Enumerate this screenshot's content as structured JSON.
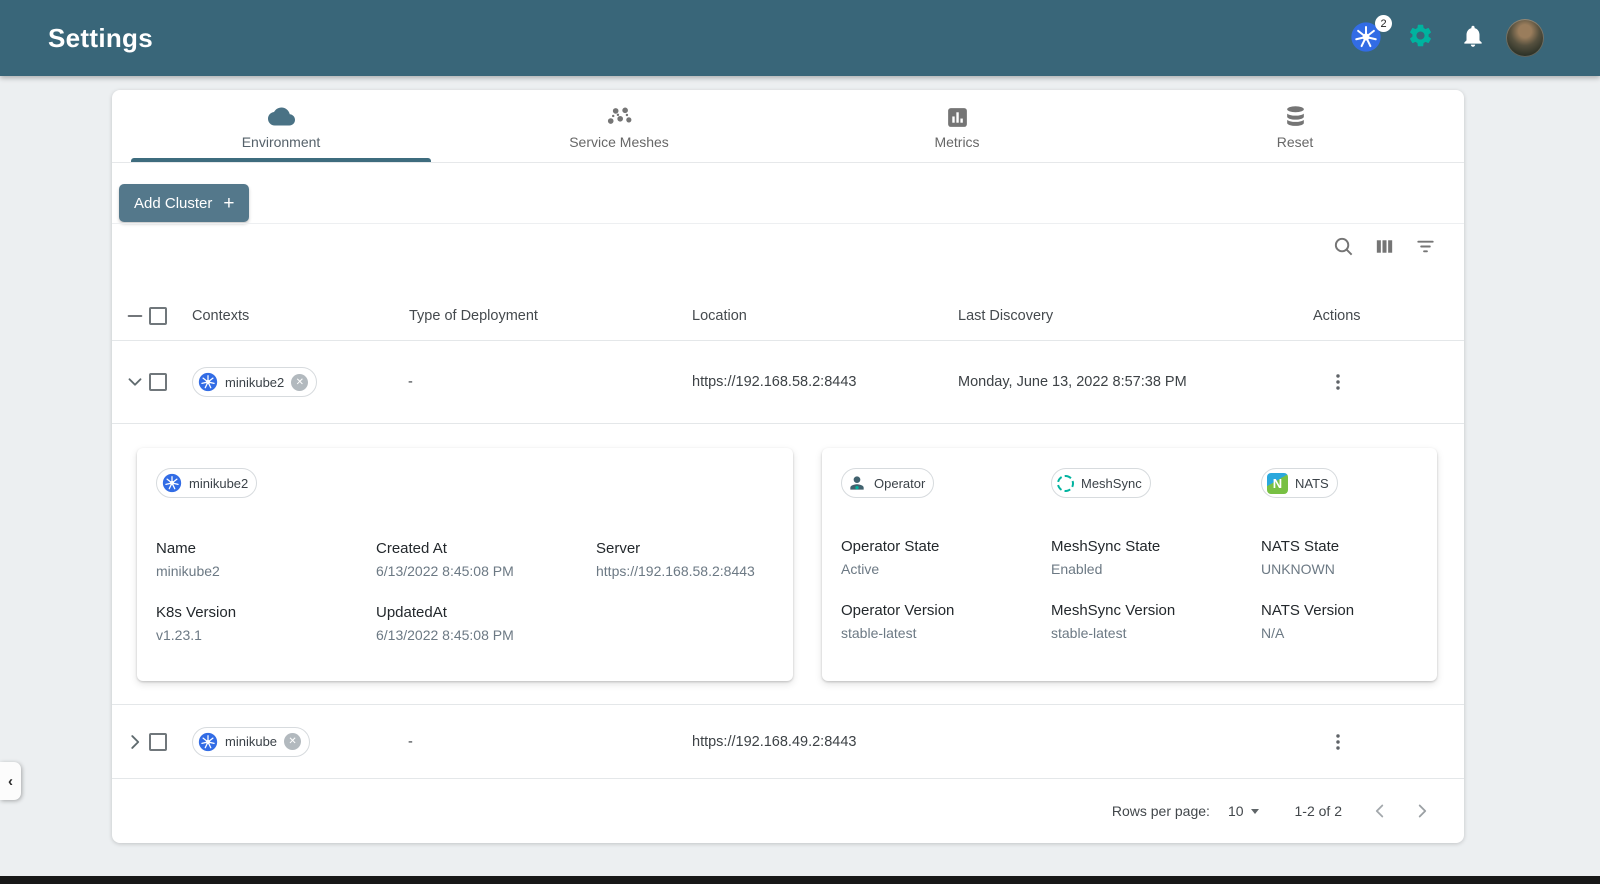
{
  "header": {
    "title": "Settings",
    "k8s_badge": "2"
  },
  "tabs": [
    {
      "label": "Environment"
    },
    {
      "label": "Service Meshes"
    },
    {
      "label": "Metrics"
    },
    {
      "label": "Reset"
    }
  ],
  "toolbar": {
    "add_cluster_label": "Add Cluster",
    "add_cluster_plus": "+"
  },
  "table": {
    "columns": [
      "Contexts",
      "Type of Deployment",
      "Location",
      "Last Discovery",
      "Actions"
    ],
    "rows": [
      {
        "context": "minikube2",
        "type_of_deployment": "-",
        "location": "https://192.168.58.2:8443",
        "last_discovery": "Monday, June 13, 2022 8:57:38 PM"
      },
      {
        "context": "minikube",
        "type_of_deployment": "-",
        "location": "https://192.168.49.2:8443",
        "last_discovery": ""
      }
    ]
  },
  "cluster_details": {
    "chip": "minikube2",
    "fields": [
      {
        "label": "Name",
        "value": "minikube2"
      },
      {
        "label": "Created At",
        "value": "6/13/2022 8:45:08 PM"
      },
      {
        "label": "Server",
        "value": "https://192.168.58.2:8443"
      },
      {
        "label": "K8s Version",
        "value": "v1.23.1"
      },
      {
        "label": "UpdatedAt",
        "value": "6/13/2022 8:45:08 PM"
      }
    ]
  },
  "operator_details": {
    "chips": [
      {
        "label": "Operator"
      },
      {
        "label": "MeshSync"
      },
      {
        "label": "NATS"
      }
    ],
    "nats_logo_letter": "N",
    "fields": [
      {
        "label": "Operator State",
        "value": "Active"
      },
      {
        "label": "MeshSync State",
        "value": "Enabled"
      },
      {
        "label": "NATS State",
        "value": "UNKNOWN"
      },
      {
        "label": "Operator Version",
        "value": "stable-latest"
      },
      {
        "label": "MeshSync Version",
        "value": "stable-latest"
      },
      {
        "label": "NATS Version",
        "value": "N/A"
      }
    ]
  },
  "pagination": {
    "rows_per_page_label": "Rows per page:",
    "rows_per_page_value": "10",
    "range_label": "1-2 of 2"
  },
  "icons": {
    "chip_delete": "✕",
    "sidebar_collapse": "‹"
  },
  "colors": {
    "header_bar": "#396679",
    "accent_green": "#00B39F",
    "kubernetes_blue": "#326CE5",
    "add_button": "#54788b",
    "active_tab_indicator": "#3e6c7e"
  }
}
